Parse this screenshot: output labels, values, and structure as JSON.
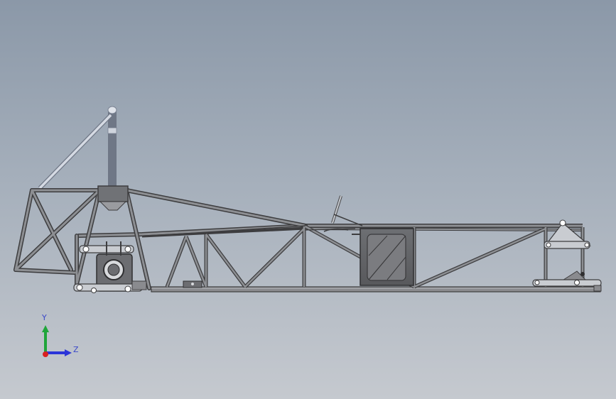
{
  "viewport": {
    "background_top": "#8b98a8",
    "background_bottom": "#c5c9cf"
  },
  "triad": {
    "y_label": "Y",
    "z_label": "Z",
    "y_color": "#1fa53a",
    "z_color": "#2b35d8",
    "x_color": "#d92020"
  },
  "model": {
    "description_icon": "chassis-frame-model",
    "tube_color": "#4a4a4c",
    "tube_highlight": "#8d8f93",
    "rollbar_color": "#b9bfcc"
  }
}
